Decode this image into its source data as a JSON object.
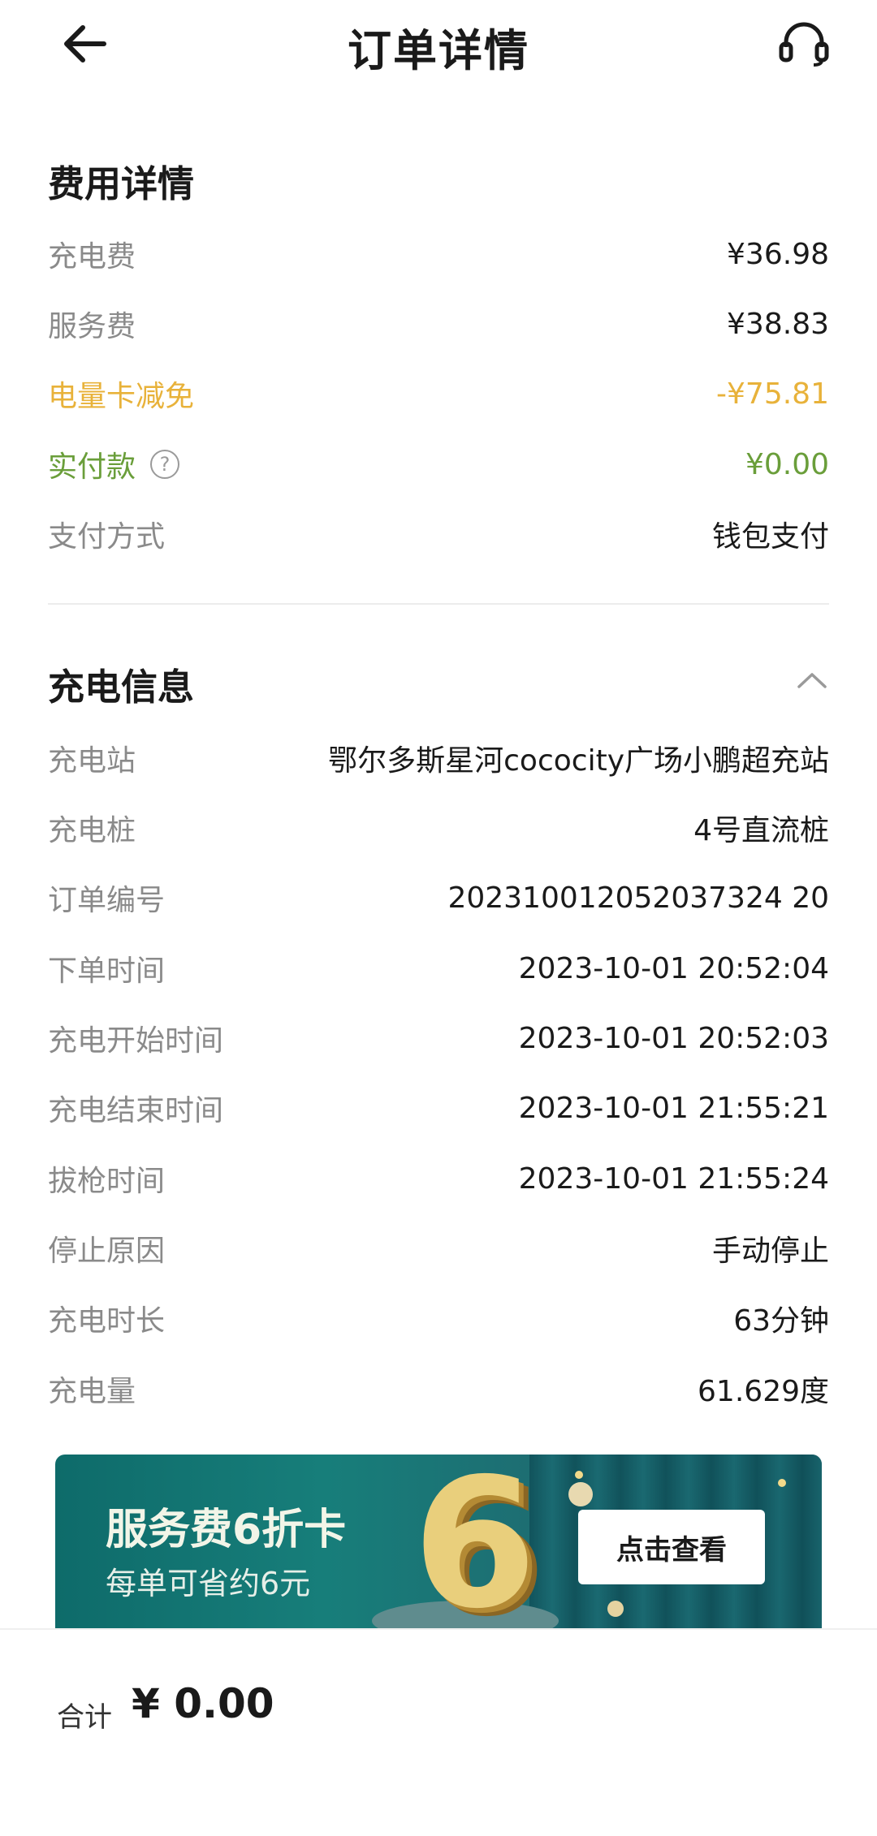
{
  "header": {
    "title": "订单详情",
    "back_icon": "arrow-left-icon",
    "support_icon": "headset-icon"
  },
  "fees": {
    "section_title": "费用详情",
    "charge_fee_label": "充电费",
    "charge_fee_value": "¥36.98",
    "service_fee_label": "服务费",
    "service_fee_value": "¥38.83",
    "discount_label": "电量卡减免",
    "discount_value": "-¥75.81",
    "paid_label": "实付款",
    "paid_help": "?",
    "paid_value": "¥0.00",
    "payment_method_label": "支付方式",
    "payment_method_value": "钱包支付"
  },
  "charging": {
    "section_title": "充电信息",
    "rows": [
      {
        "label": "充电站",
        "value": "鄂尔多斯星河cococity广场小鹏超充站"
      },
      {
        "label": "充电桩",
        "value": "4号直流桩"
      },
      {
        "label": "订单编号",
        "value": "202310012052037324 20"
      },
      {
        "label": "下单时间",
        "value": "2023-10-01 20:52:04"
      },
      {
        "label": "充电开始时间",
        "value": "2023-10-01 20:52:03"
      },
      {
        "label": "充电结束时间",
        "value": "2023-10-01 21:55:21"
      },
      {
        "label": "拔枪时间",
        "value": "2023-10-01 21:55:24"
      },
      {
        "label": "停止原因",
        "value": "手动停止"
      },
      {
        "label": "充电时长",
        "value": "63分钟"
      },
      {
        "label": "充电量",
        "value": "61.629度"
      }
    ]
  },
  "banner": {
    "title": "服务费6折卡",
    "subtitle": "每单可省约6元",
    "big_number": "6",
    "button": "点击查看"
  },
  "footer": {
    "total_label": "合计",
    "total_value": "¥ 0.00"
  },
  "colors": {
    "discount": "#e8b23a",
    "paid": "#6a9e3a",
    "banner": "#177e7a"
  }
}
